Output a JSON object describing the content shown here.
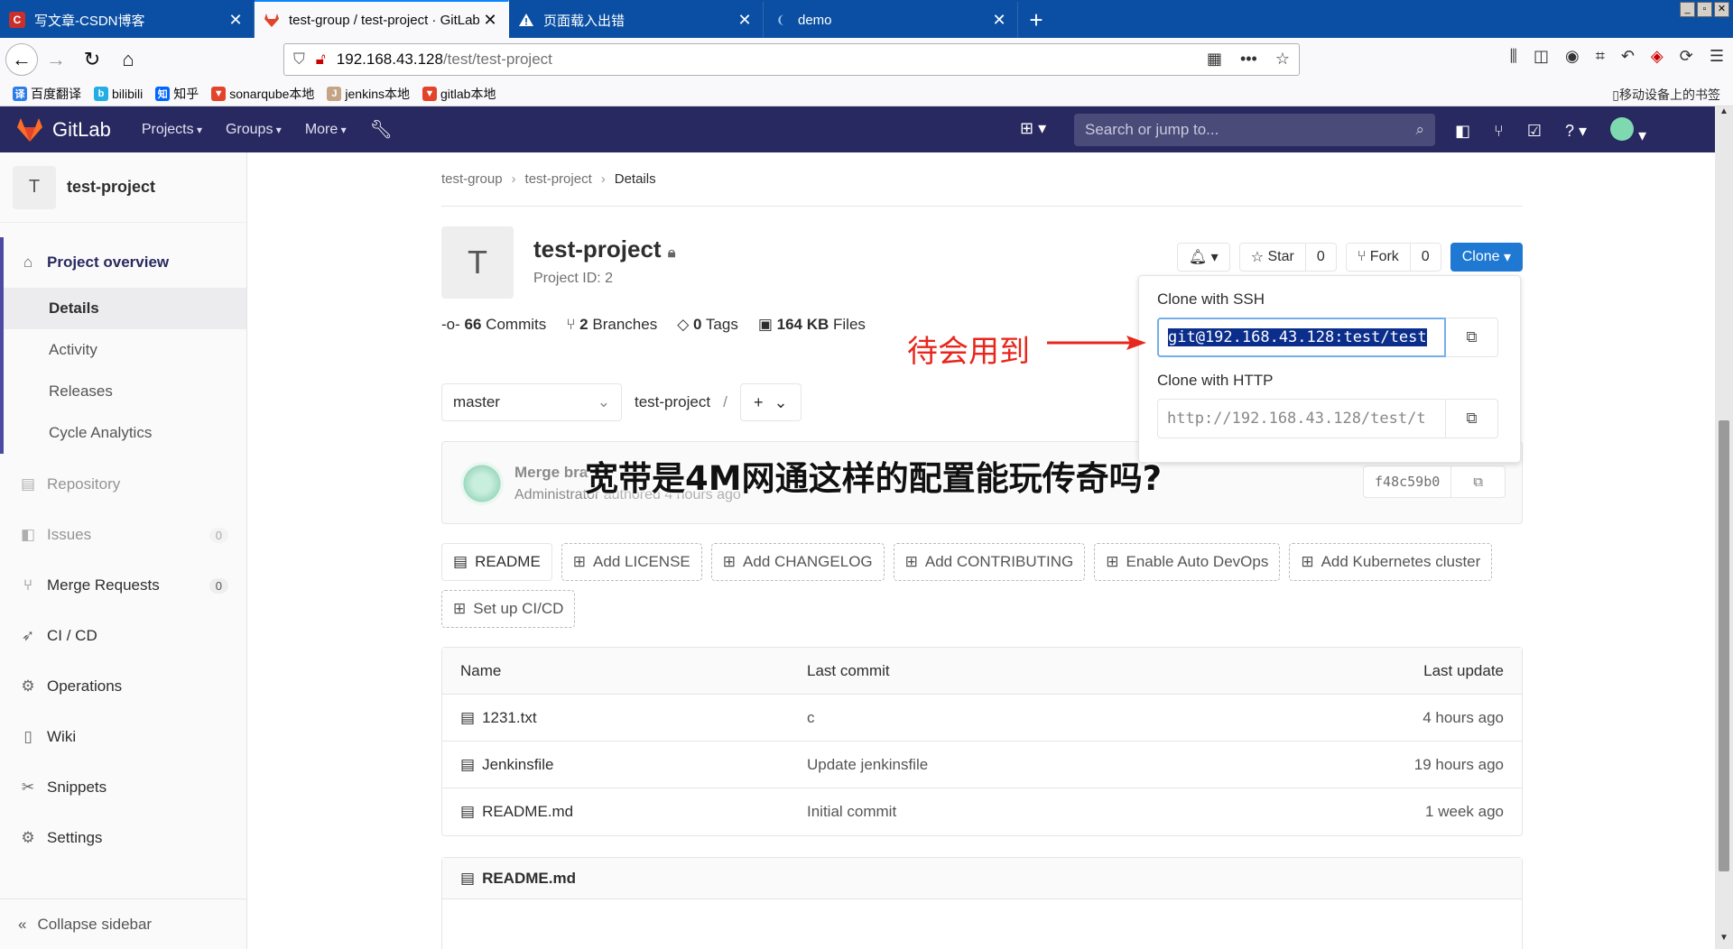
{
  "browser": {
    "tabs": [
      {
        "title": "写文章-CSDN博客",
        "icon_color": "#c9302c",
        "icon": "C"
      },
      {
        "title": "test-group / test-project · GitLab",
        "icon_color": "#e2432a",
        "icon": "gitlab-fox"
      },
      {
        "title": "页面载入出错",
        "icon_color": "#0c0c0d",
        "icon": "warning"
      },
      {
        "title": "demo",
        "icon_color": "#2a6ebb",
        "icon": "jenkins"
      }
    ],
    "url_host": "192.168.43.128",
    "url_path": "/test/test-project",
    "bookmarks": [
      {
        "label": "百度翻译",
        "icon": "译",
        "color": "#2b7de9"
      },
      {
        "label": "bilibili",
        "icon": "b",
        "color": "#23ade5"
      },
      {
        "label": "知乎",
        "icon": "知",
        "color": "#0066ff"
      },
      {
        "label": "sonarqube本地",
        "icon": "fox",
        "color": "#e2432a"
      },
      {
        "label": "jenkins本地",
        "icon": "J",
        "color": "#c4a484"
      },
      {
        "label": "gitlab本地",
        "icon": "fox",
        "color": "#e2432a"
      }
    ],
    "mobile_bookmarks": "移动设备上的书签"
  },
  "gitlab": {
    "brand": "GitLab",
    "nav": [
      "Projects",
      "Groups",
      "More"
    ],
    "search_placeholder": "Search or jump to..."
  },
  "sidebar": {
    "project_initial": "T",
    "project_name": "test-project",
    "overview": "Project overview",
    "subitems": [
      "Details",
      "Activity",
      "Releases",
      "Cycle Analytics"
    ],
    "items": [
      {
        "label": "Repository"
      },
      {
        "label": "Issues",
        "count": "0"
      },
      {
        "label": "Merge Requests",
        "count": "0"
      },
      {
        "label": "CI / CD"
      },
      {
        "label": "Operations"
      },
      {
        "label": "Wiki"
      },
      {
        "label": "Snippets"
      },
      {
        "label": "Settings"
      }
    ],
    "collapse": "Collapse sidebar"
  },
  "breadcrumb": [
    "test-group",
    "test-project",
    "Details"
  ],
  "project": {
    "initial": "T",
    "name": "test-project",
    "id_text": "Project ID: 2",
    "commits_count": "66",
    "commits_label": "Commits",
    "branches_count": "2",
    "branches_label": "Branches",
    "tags_count": "0",
    "tags_label": "Tags",
    "files_size": "164 KB",
    "files_label": "Files"
  },
  "actions": {
    "star": "Star",
    "star_count": "0",
    "fork": "Fork",
    "fork_count": "0",
    "clone": "Clone"
  },
  "clone": {
    "ssh_label": "Clone with SSH",
    "ssh_url": "git@192.168.43.128:test/test",
    "http_label": "Clone with HTTP",
    "http_url": "http://192.168.43.128/test/t"
  },
  "repo": {
    "branch": "master",
    "path": "test-project",
    "path_sep": "/"
  },
  "commit": {
    "message": "Merge bra",
    "author": "Administrator",
    "time": "authored 4 hours ago",
    "sha": "f48c59b0"
  },
  "quick_actions": [
    "README",
    "Add LICENSE",
    "Add CHANGELOG",
    "Add CONTRIBUTING",
    "Enable Auto DevOps",
    "Add Kubernetes cluster",
    "Set up CI/CD"
  ],
  "tree": {
    "headers": [
      "Name",
      "Last commit",
      "Last update"
    ],
    "rows": [
      {
        "name": "1231.txt",
        "commit": "c",
        "updated": "4 hours ago"
      },
      {
        "name": "Jenkinsfile",
        "commit": "Update jenkinsfile",
        "updated": "19 hours ago"
      },
      {
        "name": "README.md",
        "commit": "Initial commit",
        "updated": "1 week ago"
      }
    ]
  },
  "readme_title": "README.md",
  "annotation": "待会用到",
  "banner": "宽带是4M网通这样的配置能玩传奇吗?",
  "colors": {
    "header": "#292961",
    "clone_button": "#1f78d1",
    "annotation": "#e8261c"
  }
}
